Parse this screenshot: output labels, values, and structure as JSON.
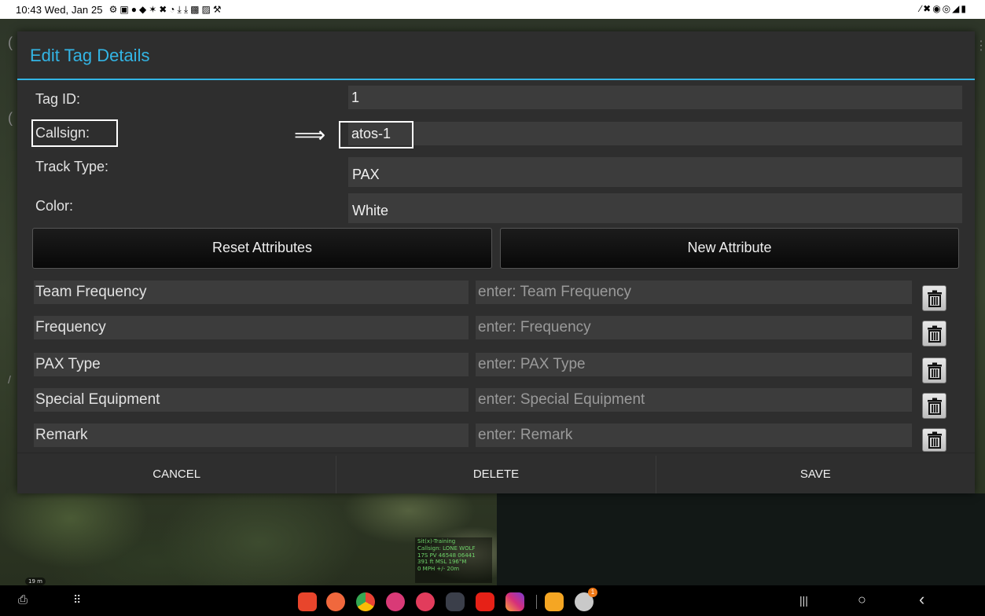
{
  "status_bar": {
    "time": "10:43",
    "date": "Wed, Jan 25",
    "notification_icons": "⚙▣●◆✶✖◔⤓⤓▩▨⚒",
    "system_icons": "∕✖◉◎◢▮"
  },
  "dialog": {
    "title": "Edit Tag Details",
    "fields": {
      "tag_id": {
        "label": "Tag ID:",
        "value": "1"
      },
      "callsign": {
        "label": "Callsign:",
        "value": "atos-1"
      },
      "track_type": {
        "label": "Track Type:",
        "value": "PAX"
      },
      "color": {
        "label": "Color:",
        "value": "White"
      }
    },
    "arrow": "⟹",
    "reset_button": "Reset Attributes",
    "new_button": "New Attribute",
    "attributes": [
      {
        "name": "Team Frequency",
        "placeholder": "enter: Team Frequency"
      },
      {
        "name": "Frequency",
        "placeholder": "enter: Frequency"
      },
      {
        "name": "PAX Type",
        "placeholder": "enter: PAX Type"
      },
      {
        "name": "Special Equipment",
        "placeholder": "enter: Special Equipment"
      },
      {
        "name": "Remark",
        "placeholder": "enter: Remark"
      }
    ],
    "cancel_label": "CANCEL",
    "delete_label": "DELETE",
    "save_label": "SAVE"
  },
  "map_info": {
    "line1": "Sit(x)-Training",
    "line2": "Callsign: LONE WOLF",
    "line3": "17S PV 46548 06441",
    "line4": "391 ft MSL    196°M",
    "line5": "0 MPH        +/- 20m"
  },
  "scale_label": "19 m",
  "colors": {
    "accent": "#33b5e5",
    "dialog_bg": "#2e2e2e",
    "field_bg": "#3c3c3c",
    "map_text": "#6fd36a"
  },
  "dock_icons": [
    "screenshot-icon",
    "apps-icon",
    "flipboard-icon",
    "contacts-icon",
    "chrome-icon",
    "blossom-icon",
    "camera-icon",
    "more-apps-icon",
    "youtube-icon",
    "instagram-icon",
    "files-icon",
    "atak-icon"
  ],
  "nav_buttons": {
    "recents": "|||",
    "home": "○",
    "back": "‹"
  },
  "atak_badge": "1"
}
